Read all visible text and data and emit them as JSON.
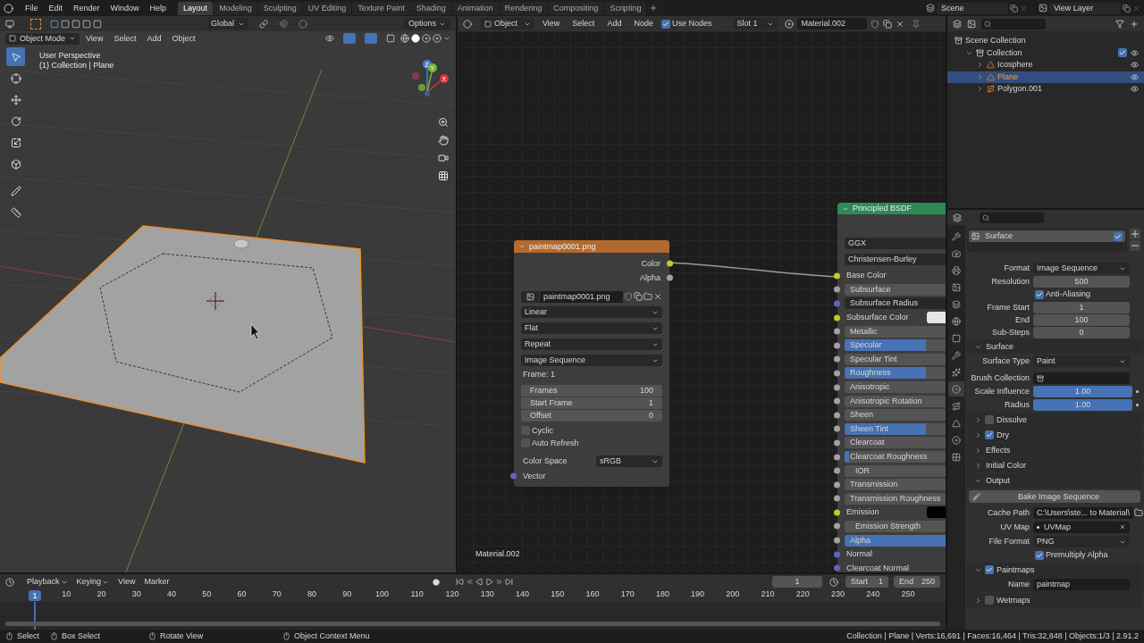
{
  "menu": [
    "File",
    "Edit",
    "Render",
    "Window",
    "Help"
  ],
  "workspaces": [
    {
      "label": "Layout",
      "selected": true
    },
    {
      "label": "Modeling",
      "selected": false
    },
    {
      "label": "Sculpting",
      "selected": false
    },
    {
      "label": "UV Editing",
      "selected": false
    },
    {
      "label": "Texture Paint",
      "selected": false
    },
    {
      "label": "Shading",
      "selected": false
    },
    {
      "label": "Animation",
      "selected": false
    },
    {
      "label": "Rendering",
      "selected": false
    },
    {
      "label": "Compositing",
      "selected": false
    },
    {
      "label": "Scripting",
      "selected": false
    }
  ],
  "scene": "Scene",
  "view_layer": "View Layer",
  "viewport": {
    "transform_orientation": "Global",
    "options": "Options",
    "mode": "Object Mode",
    "menus": [
      "View",
      "Select",
      "Add",
      "Object"
    ],
    "view_name": "User Perspective",
    "view_object": "(1) Collection | Plane",
    "gizmo_axes": [
      "X",
      "Y",
      "Z"
    ],
    "tools": [
      {
        "selected": true
      },
      {
        "selected": false
      },
      {
        "selected": false
      },
      {
        "selected": false
      },
      {
        "selected": false
      },
      {
        "selected": false
      },
      {
        "selected": false
      },
      {
        "selected": false
      }
    ]
  },
  "node_editor": {
    "object": "Object",
    "menus": [
      "View",
      "Select",
      "Add",
      "Node"
    ],
    "use_nodes": {
      "label": "Use Nodes",
      "checked": true
    },
    "slot": "Slot 1",
    "material": "Material.002",
    "footer_material": "Material.002",
    "image_node": {
      "title": "paintmap0001.png",
      "outputs": [
        {
          "label": "Color",
          "color": "#c7c729"
        },
        {
          "label": "Alpha",
          "color": "#a1a1a1"
        }
      ],
      "image": "paintmap0001.png",
      "dropdowns": [
        "Linear",
        "Flat",
        "Repeat",
        "Image Sequence"
      ],
      "frame": "Frame: 1",
      "fields": [
        {
          "label": "Frames",
          "value": "100"
        },
        {
          "label": "Start Frame",
          "value": "1"
        },
        {
          "label": "Offset",
          "value": "0"
        }
      ],
      "checkboxes": [
        {
          "label": "Cyclic",
          "checked": false
        },
        {
          "label": "Auto Refresh",
          "checked": false
        }
      ],
      "color_space": {
        "label": "Color Space",
        "value": "sRGB"
      },
      "inputs": [
        {
          "label": "Vector",
          "color": "#6363c7"
        }
      ]
    },
    "bsdf": {
      "title": "Principled BSDF",
      "dropdowns": [
        "GGX",
        "Christensen-Burley"
      ],
      "inputs": [
        {
          "kind": "socket",
          "label": "Base Color",
          "color": "#c7c729"
        },
        {
          "kind": "slider",
          "label": "Subsurface",
          "color": "#a1a1a1",
          "level": 0
        },
        {
          "kind": "vector",
          "label": "Subsurface Radius",
          "color": "#6363c7"
        },
        {
          "kind": "swatch",
          "label": "Subsurface Color",
          "color": "#e6e6e6"
        },
        {
          "kind": "slider",
          "label": "Metallic",
          "color": "#a1a1a1",
          "level": 0
        },
        {
          "kind": "slider",
          "label": "Specular",
          "color": "#a1a1a1",
          "level": 0.5
        },
        {
          "kind": "slider",
          "label": "Specular Tint",
          "color": "#a1a1a1",
          "level": 0
        },
        {
          "kind": "slider",
          "label": "Roughness",
          "color": "#a1a1a1",
          "level": 0.5
        },
        {
          "kind": "slider",
          "label": "Anisotropic",
          "color": "#a1a1a1",
          "level": 0
        },
        {
          "kind": "slider",
          "label": "Anisotropic Rotation",
          "color": "#a1a1a1",
          "level": 0
        },
        {
          "kind": "slider",
          "label": "Sheen",
          "color": "#a1a1a1",
          "level": 0
        },
        {
          "kind": "slider",
          "label": "Sheen Tint",
          "color": "#a1a1a1",
          "level": 0.5
        },
        {
          "kind": "slider",
          "label": "Clearcoat",
          "color": "#a1a1a1",
          "level": 0
        },
        {
          "kind": "slider",
          "label": "Clearcoat Roughness",
          "color": "#a1a1a1",
          "level": 0.03
        },
        {
          "kind": "number",
          "label": "IOR",
          "color": "#a1a1a1"
        },
        {
          "kind": "slider",
          "label": "Transmission",
          "color": "#a1a1a1",
          "level": 0
        },
        {
          "kind": "slider",
          "label": "Transmission Roughness",
          "color": "#a1a1a1",
          "level": 0
        },
        {
          "kind": "swatch",
          "label": "Emission",
          "color": "#000000"
        },
        {
          "kind": "number",
          "label": "Emission Strength",
          "color": "#a1a1a1"
        },
        {
          "kind": "slider",
          "label": "Alpha",
          "color": "#a1a1a1",
          "level": 1
        },
        {
          "kind": "socket",
          "label": "Normal",
          "color": "#6363c7"
        },
        {
          "kind": "socket",
          "label": "Clearcoat Normal",
          "color": "#6363c7"
        }
      ]
    }
  },
  "outliner": {
    "tree": [
      {
        "kind": "scene_collection",
        "label": "Scene Collection",
        "selected": false,
        "children": [
          {
            "kind": "collection",
            "label": "Collection",
            "expanded": true,
            "checked": true,
            "visible": true,
            "selected": false,
            "children": [
              {
                "kind": "mesh",
                "label": "Icosphere",
                "expanded": false,
                "visible": true,
                "selected": false
              },
              {
                "kind": "mesh",
                "label": "Plane",
                "expanded": false,
                "visible": true,
                "selected": true
              },
              {
                "kind": "curve",
                "label": "Polygon.001",
                "expanded": false,
                "visible": true,
                "selected": false
              }
            ]
          }
        ]
      }
    ]
  },
  "properties": {
    "tabs": [
      {
        "selected": false
      },
      {
        "selected": false
      },
      {
        "selected": false
      },
      {
        "selected": false
      },
      {
        "selected": false
      },
      {
        "selected": false
      },
      {
        "selected": false
      },
      {
        "selected": false
      },
      {
        "selected": false
      },
      {
        "selected": true
      },
      {
        "selected": false
      },
      {
        "selected": false
      },
      {
        "selected": false
      },
      {
        "selected": false
      }
    ],
    "list_item": {
      "label": "Surface",
      "checked": true
    },
    "rows": [
      {
        "kind": "dropdown",
        "label": "Format",
        "value": "Image Sequence"
      },
      {
        "kind": "number",
        "label": "Resolution",
        "value": "500"
      },
      {
        "kind": "checkbox",
        "label": "Anti-Aliasing",
        "checked": true
      },
      {
        "kind": "number",
        "label": "Frame Start",
        "value": "1"
      },
      {
        "kind": "number",
        "label": "End",
        "value": "100"
      },
      {
        "kind": "number",
        "label": "Sub-Steps",
        "value": "0"
      },
      {
        "kind": "section",
        "label": "Surface",
        "expanded": true
      },
      {
        "kind": "dropdown",
        "label": "Surface Type",
        "value": "Paint"
      },
      {
        "kind": "collection",
        "label": "Brush Collection"
      },
      {
        "kind": "slider",
        "label": "Scale Influence",
        "value": "1.00",
        "level": 1
      },
      {
        "kind": "slider",
        "label": "Radius",
        "value": "1.00",
        "level": 1
      },
      {
        "kind": "subpanel",
        "label": "Dissolve",
        "expanded": false,
        "checked": false
      },
      {
        "kind": "subpanel",
        "label": "Dry",
        "expanded": false,
        "checked": true
      },
      {
        "kind": "section",
        "label": "Effects",
        "expanded": false
      },
      {
        "kind": "section",
        "label": "Initial Color",
        "expanded": false
      },
      {
        "kind": "section",
        "label": "Output",
        "expanded": true
      },
      {
        "kind": "button",
        "label": "Bake Image Sequence"
      },
      {
        "kind": "path",
        "label": "Cache Path",
        "value": "C:\\Users\\ste... to Material\\"
      },
      {
        "kind": "uvmap",
        "label": "UV Map",
        "value": "UVMap"
      },
      {
        "kind": "dropdown",
        "label": "File Format",
        "value": "PNG"
      },
      {
        "kind": "checkbox",
        "label": "Premultiply Alpha",
        "checked": true
      },
      {
        "kind": "subpanel",
        "label": "Paintmaps",
        "expanded": true,
        "checked": true
      },
      {
        "kind": "text",
        "label": "Name",
        "value": "paintmap"
      },
      {
        "kind": "subpanel",
        "label": "Wetmaps",
        "expanded": false,
        "checked": false
      }
    ]
  },
  "timeline": {
    "menus": [
      {
        "label": "Playback",
        "dropdown": true
      },
      {
        "label": "Keying",
        "dropdown": true
      },
      {
        "label": "View",
        "dropdown": false
      },
      {
        "label": "Marker",
        "dropdown": false
      }
    ],
    "current_frame": "1",
    "start": {
      "label": "Start",
      "value": "1"
    },
    "end": {
      "label": "End",
      "value": "250"
    },
    "playhead": "1",
    "ruler": [
      "10",
      "20",
      "30",
      "40",
      "50",
      "60",
      "70",
      "80",
      "90",
      "100",
      "110",
      "120",
      "130",
      "140",
      "150",
      "160",
      "170",
      "180",
      "190",
      "200",
      "210",
      "220",
      "230",
      "240",
      "250"
    ]
  },
  "status_bar": {
    "hints": [
      "Select",
      "Box Select",
      "Rotate View",
      "Object Context Menu"
    ],
    "stats": "Collection | Plane | Verts:16,691 | Faces:16,464 | Tris:32,848 | Objects:1/3 | 2.91.2"
  }
}
